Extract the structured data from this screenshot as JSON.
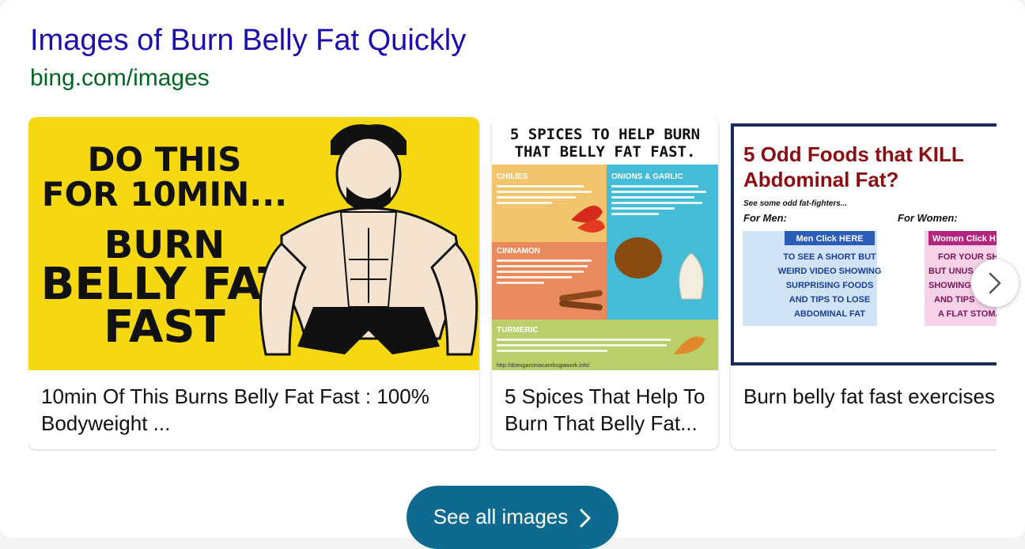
{
  "result": {
    "title": "Images of Burn Belly Fat Quickly",
    "url": "bing.com/images"
  },
  "images": [
    {
      "caption": "10min Of This Burns Belly Fat Fast : 100% Bodyweight ...",
      "poster": [
        "DO THIS",
        "FOR 10MIN...",
        "BURN",
        "BELLY FAT",
        "FAST"
      ]
    },
    {
      "caption": "5 Spices That Help To Burn That Belly Fat...",
      "heading": [
        "5 SPICES TO HELP BURN",
        "THAT BELLY FAT FAST."
      ],
      "sections": {
        "chilies": "CHILIES",
        "onions": "ONIONS & GARLIC",
        "cinnamon": "CINNAMON",
        "turmeric": "TURMERIC"
      },
      "footer_url": "http://doesgarciniacambogiawork.info/"
    },
    {
      "caption": "Burn belly fat fast exercises",
      "heading": [
        "5 Odd Foods that KILL",
        "Abdominal Fat?"
      ],
      "subheading": "See some odd fat-fighters...",
      "for_men": "For Men:",
      "for_women": "For Women:",
      "men_box": [
        "Men Click HERE",
        "TO SEE A SHORT BUT",
        "WEIRD VIDEO SHOWING",
        "SURPRISING FOODS",
        "AND TIPS TO LOSE",
        "ABDOMINAL FAT"
      ],
      "women_box": [
        "Women Click H",
        "FOR YOUR SHO",
        "BUT UNUS",
        "SHOWING",
        "AND TIPS",
        "A FLAT STOMA"
      ]
    }
  ],
  "see_all_label": "See all images",
  "colors": {
    "title": "#1a0dab",
    "url": "#006621",
    "poster_yellow": "#f5d80f",
    "button": "#0e6a8f"
  }
}
